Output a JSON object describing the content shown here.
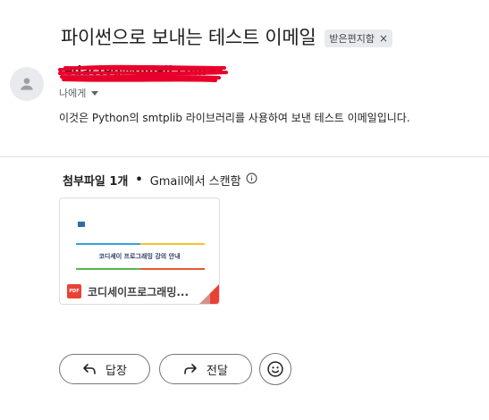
{
  "email": {
    "subject": "파이썬으로 보내는 테스트 이메일",
    "label": "받은편지함",
    "label_close": "×",
    "sender": "redacted@gmail.com",
    "to": "나에게",
    "body": "이것은 Python의 smtplib 라이브러리를 사용하여 보낸 테스트 이메일입니다."
  },
  "attachments": {
    "title": "첨부파일 1개",
    "scan_text": "Gmail에서 스캔함",
    "info_icon": "info-icon",
    "items": [
      {
        "name": "코디세이프로그래밍...",
        "type_badge": "PDF",
        "thumb_org": "",
        "thumb_title": "코디세이 프로그래밍 강의 안내"
      }
    ]
  },
  "actions": {
    "reply": "답장",
    "forward": "전달"
  },
  "colors": {
    "accent_red": "#e94235",
    "redaction": "#e8002a",
    "chip_bg": "#e8eaed"
  }
}
